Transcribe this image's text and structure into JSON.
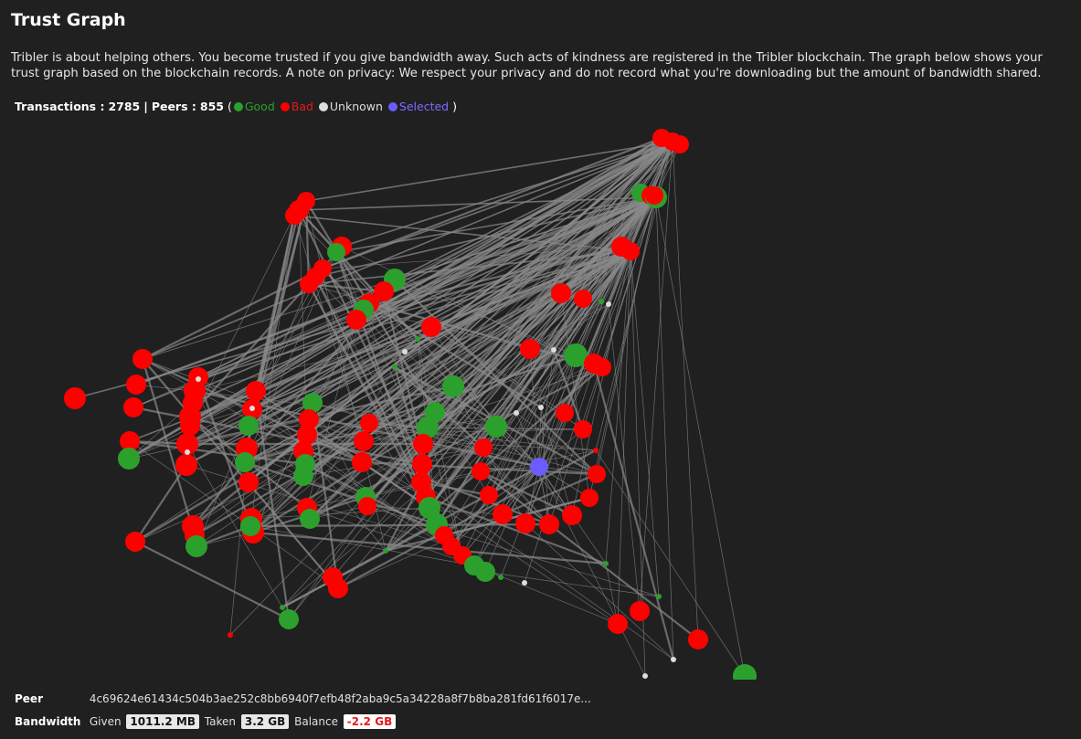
{
  "header": {
    "title": "Trust Graph",
    "description": "Tribler is about helping others. You become trusted if you give bandwidth away. Such acts of kindness are registered in the Tribler blockchain. The graph below shows your trust graph based on the blockchain records. A note on privacy: We respect your privacy and do not record what you're downloading but the amount of bandwidth shared."
  },
  "stats": {
    "transactions_label": "Transactions :",
    "transactions": "2785",
    "peers_label": "Peers :",
    "peers": "855",
    "separator": "|",
    "legend": {
      "good": "Good",
      "bad": "Bad",
      "unknown": "Unknown",
      "selected": "Selected"
    }
  },
  "colors": {
    "good": "#2ca02c",
    "bad": "#ff0000",
    "unknown": "#dddddd",
    "selected": "#6a5cff",
    "edge": "#8a8a8a",
    "background": "#202020"
  },
  "peer_info": {
    "peer_label": "Peer",
    "peer_value": "4c69624e61434c504b3ae252c8bb6940f7efb48f2aba9c5a34228a8f7b8ba281fd61f6017e...",
    "bandwidth_label": "Bandwidth",
    "given_label": "Given",
    "given_value": "1011.2 MB",
    "taken_label": "Taken",
    "taken_value": "3.2 GB",
    "balance_label": "Balance",
    "balance_value": "-2.2 GB"
  }
}
